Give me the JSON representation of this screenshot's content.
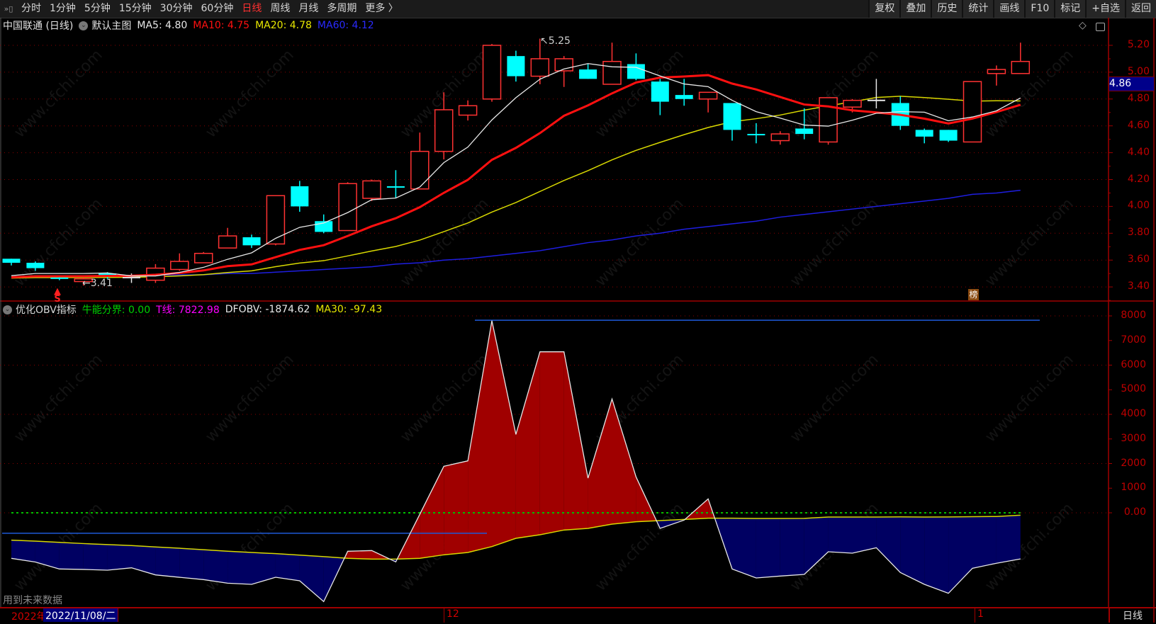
{
  "toolbar": {
    "periods": [
      "分时",
      "1分钟",
      "5分钟",
      "15分钟",
      "30分钟",
      "60分钟",
      "日线",
      "周线",
      "月线",
      "多周期",
      "更多 〉"
    ],
    "active_period": "日线",
    "buttons": [
      "复权",
      "叠加",
      "历史",
      "统计",
      "画线",
      "F10",
      "标记",
      "+自选",
      "返回"
    ]
  },
  "main_header": {
    "stock": "中国联通 (日线)",
    "template": "默认主图",
    "ma5": "MA5: 4.80",
    "ma10": "MA10: 4.75",
    "ma20": "MA20: 4.78",
    "ma60": "MA60: 4.12"
  },
  "indicator_header": {
    "name": "优化OBV指标",
    "bull_line": "牛能分界: 0.00",
    "t_line": "T线: 7822.98",
    "dfobv": "DFOBV: -1874.62",
    "ma30": "MA30: -97.43"
  },
  "price_axis": [
    "5.20",
    "5.00",
    "4.80",
    "4.60",
    "4.40",
    "4.20",
    "4.00",
    "3.80",
    "3.60",
    "3.40"
  ],
  "current_price": "4.86",
  "obv_axis": [
    "8000",
    "7000",
    "6000",
    "5000",
    "4000",
    "3000",
    "2000",
    "1000",
    "0.00"
  ],
  "annotations": {
    "high": "5.25",
    "low": "3.41",
    "signal": "S",
    "badge": "榜",
    "future_data": "用到未来数据"
  },
  "bottom": {
    "year": "2022年",
    "cursor_date": "2022/11/08/二",
    "month_12": "12",
    "month_1": "1",
    "period": "日线"
  },
  "watermark": "www.cfchi.com",
  "colors": {
    "up": "#ff3232",
    "down": "#00ffff",
    "ma5": "#e8e8e8",
    "ma10": "#ff1010",
    "ma20": "#d8d800",
    "ma60": "#1e1ee0",
    "obv_pos": "#a00000",
    "obv_neg": "#000062"
  },
  "chart_data": [
    {
      "type": "candlestick",
      "title": "中国联通 (日线)",
      "ylim": [
        3.3,
        5.3
      ],
      "candles": [
        [
          3.61,
          3.61,
          3.56,
          3.58
        ],
        [
          3.58,
          3.59,
          3.52,
          3.54
        ],
        [
          3.47,
          3.48,
          3.45,
          3.46
        ],
        [
          3.44,
          3.47,
          3.41,
          3.46
        ],
        [
          3.5,
          3.51,
          3.46,
          3.48
        ],
        [
          3.47,
          3.5,
          3.43,
          3.47
        ],
        [
          3.45,
          3.57,
          3.43,
          3.54
        ],
        [
          3.53,
          3.65,
          3.52,
          3.59
        ],
        [
          3.58,
          3.66,
          3.58,
          3.65
        ],
        [
          3.69,
          3.84,
          3.69,
          3.78
        ],
        [
          3.77,
          3.79,
          3.69,
          3.71
        ],
        [
          3.72,
          4.08,
          3.71,
          4.08
        ],
        [
          4.15,
          4.19,
          3.96,
          4.0
        ],
        [
          3.89,
          3.94,
          3.8,
          3.81
        ],
        [
          3.82,
          4.18,
          3.82,
          4.17
        ],
        [
          4.06,
          4.2,
          4.04,
          4.19
        ],
        [
          4.15,
          4.27,
          4.06,
          4.14
        ],
        [
          4.13,
          4.55,
          4.13,
          4.41
        ],
        [
          4.41,
          4.85,
          4.35,
          4.72
        ],
        [
          4.68,
          4.79,
          4.64,
          4.75
        ],
        [
          4.8,
          5.21,
          4.78,
          5.2
        ],
        [
          5.12,
          5.16,
          4.93,
          4.97
        ],
        [
          4.97,
          5.25,
          4.91,
          5.1
        ],
        [
          5.01,
          5.12,
          4.89,
          5.1
        ],
        [
          5.02,
          5.06,
          4.95,
          4.95
        ],
        [
          4.91,
          5.22,
          4.91,
          5.08
        ],
        [
          5.06,
          5.14,
          4.94,
          4.95
        ],
        [
          4.93,
          4.95,
          4.68,
          4.78
        ],
        [
          4.83,
          4.95,
          4.75,
          4.8
        ],
        [
          4.8,
          4.85,
          4.7,
          4.85
        ],
        [
          4.77,
          4.77,
          4.49,
          4.57
        ],
        [
          4.54,
          4.62,
          4.47,
          4.53
        ],
        [
          4.49,
          4.56,
          4.46,
          4.54
        ],
        [
          4.58,
          4.73,
          4.5,
          4.54
        ],
        [
          4.48,
          4.81,
          4.46,
          4.81
        ],
        [
          4.74,
          4.8,
          4.7,
          4.79
        ],
        [
          4.79,
          4.95,
          4.73,
          4.79
        ],
        [
          4.77,
          4.82,
          4.57,
          4.6
        ],
        [
          4.57,
          4.58,
          4.47,
          4.52
        ],
        [
          4.57,
          4.57,
          4.48,
          4.49
        ],
        [
          4.48,
          4.93,
          4.48,
          4.93
        ],
        [
          4.99,
          5.05,
          4.9,
          5.02
        ],
        [
          4.99,
          5.22,
          4.99,
          5.08
        ]
      ],
      "candle_fields": [
        "open",
        "high",
        "low",
        "close"
      ],
      "ma60": [
        3.47,
        3.47,
        3.47,
        3.48,
        3.48,
        3.48,
        3.49,
        3.49,
        3.49,
        3.5,
        3.5,
        3.51,
        3.52,
        3.53,
        3.54,
        3.55,
        3.57,
        3.58,
        3.6,
        3.61,
        3.63,
        3.65,
        3.67,
        3.7,
        3.73,
        3.75,
        3.78,
        3.8,
        3.83,
        3.85,
        3.87,
        3.89,
        3.92,
        3.94,
        3.96,
        3.98,
        4.0,
        4.02,
        4.04,
        4.06,
        4.09,
        4.1,
        4.12
      ]
    },
    {
      "type": "area",
      "title": "优化OBV指标",
      "ylim": [
        -4000,
        8500
      ],
      "dfobv": [
        -1851,
        -2000,
        -2283,
        -2300,
        -2331,
        -2235,
        -2523,
        -2620,
        -2714,
        -2860,
        -2906,
        -2619,
        -2763,
        -3607,
        -1563,
        -1535,
        -1995,
        -60,
        1890,
        2110,
        7807,
        3185,
        6542,
        6542,
        1410,
        4624,
        1458,
        -633,
        -297,
        566,
        -2283,
        -2647,
        -2570,
        -2504,
        -1583,
        -1640,
        -1420,
        -2427,
        -2906,
        -3271,
        -2254,
        -2050,
        -1875
      ],
      "ma30": [
        -1113,
        -1150,
        -1200,
        -1250,
        -1290,
        -1330,
        -1390,
        -1440,
        -1500,
        -1560,
        -1610,
        -1660,
        -1720,
        -1780,
        -1850,
        -1880,
        -1880,
        -1850,
        -1707,
        -1611,
        -1372,
        -1036,
        -892,
        -700,
        -633,
        -460,
        -365,
        -317,
        -269,
        -221,
        -221,
        -230,
        -230,
        -225,
        -173,
        -173,
        -173,
        -165,
        -173,
        -170,
        -160,
        -150,
        -97
      ],
      "t_line": 7822.98,
      "bull_line": 0,
      "b_line": -830
    }
  ]
}
